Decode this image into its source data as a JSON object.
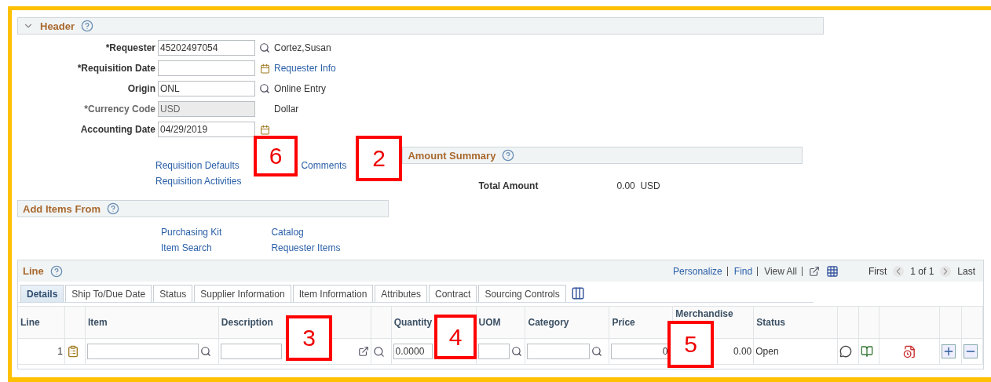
{
  "header": {
    "title": "Header",
    "expanded": true,
    "fields": [
      {
        "label": "*Requester",
        "value": "45202497054",
        "disabled": false,
        "lookup": true,
        "note": "Cortez,Susan"
      },
      {
        "label": "*Requisition Date",
        "disabled": false,
        "calendar": true,
        "link": "Requester Info"
      },
      {
        "label": "Origin",
        "value": "ONL",
        "disabled": false,
        "lookup": true,
        "note": "Online Entry"
      },
      {
        "label": "*Currency Code",
        "value": "USD",
        "disabled": true,
        "note": "Dollar"
      },
      {
        "label": "Accounting Date",
        "value": "04/29/2019",
        "disabled": false,
        "calendar": true
      }
    ],
    "links": [
      [
        "Requisition Defaults",
        "Requisition Activities"
      ],
      [
        "Comments"
      ]
    ]
  },
  "amount_summary": {
    "title": "Amount Summary",
    "label": "Total Amount",
    "value": "0.00",
    "currency": "USD"
  },
  "add_items": {
    "title": "Add Items From",
    "links": [
      [
        "Purchasing Kit",
        "Item Search"
      ],
      [
        "Catalog",
        "Requester Items"
      ]
    ]
  },
  "line": {
    "title": "Line",
    "toolbar": [
      "Personalize",
      "Find",
      "View All"
    ],
    "nav": {
      "first": "First",
      "count": "1 of 1",
      "last": "Last"
    },
    "tabs": [
      {
        "label": "Details",
        "selected": true
      },
      {
        "label": "Ship To/Due Date",
        "selected": false
      },
      {
        "label": "Status",
        "selected": false
      },
      {
        "label": "Supplier Information",
        "selected": false
      },
      {
        "label": "Item Information",
        "selected": false
      },
      {
        "label": "Attributes",
        "selected": false
      },
      {
        "label": "Contract",
        "selected": false
      },
      {
        "label": "Sourcing Controls",
        "selected": false
      }
    ],
    "columns": [
      {
        "label": "Line"
      },
      {},
      {
        "label": "Item"
      },
      {
        "label": "Description"
      },
      {},
      {
        "label": "Quantity"
      },
      {
        "label": "UOM"
      },
      {
        "label": "Category"
      },
      {
        "label": "Price"
      },
      {
        "label": "Merchandise"
      },
      {
        "label": "Status"
      },
      {},
      {},
      {},
      {},
      {}
    ],
    "row": {
      "line": "1",
      "quantity": "0.0000",
      "price": "0",
      "merchandise": "0.00",
      "status": "Open"
    }
  },
  "callouts": [
    {
      "label": "6"
    },
    {
      "label": "2"
    },
    {
      "label": "3"
    },
    {
      "label": "4"
    },
    {
      "label": "5"
    }
  ]
}
